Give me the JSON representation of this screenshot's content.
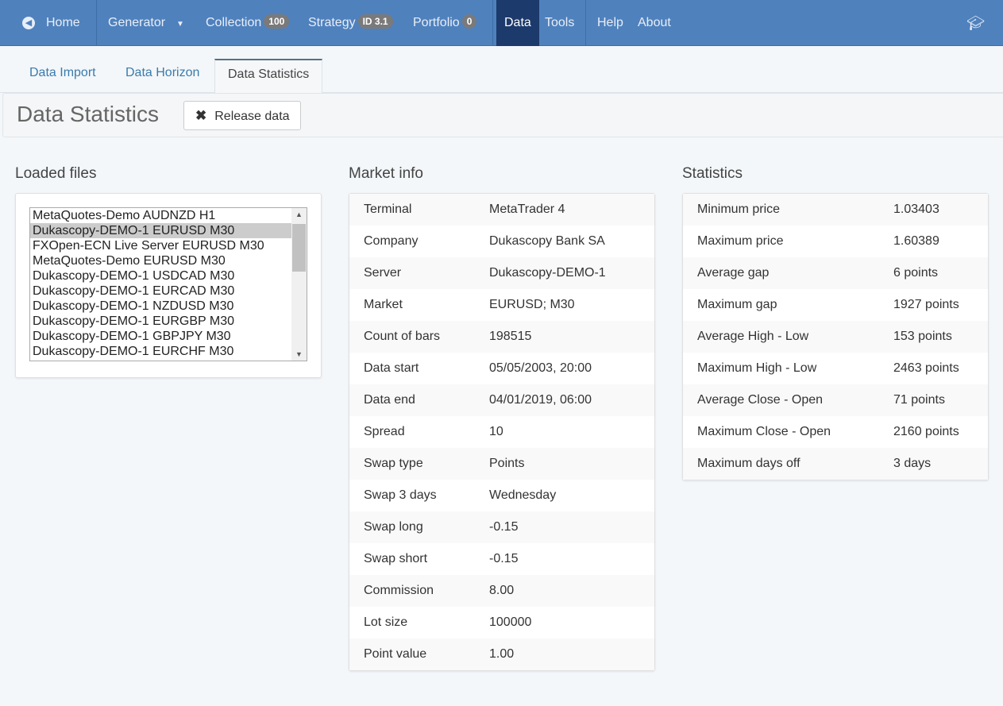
{
  "nav": {
    "home": "Home",
    "generator": "Generator",
    "collection": "Collection",
    "collection_count": "100",
    "strategy": "Strategy",
    "strategy_id": "ID 3.1",
    "portfolio": "Portfolio",
    "portfolio_count": "0",
    "data": "Data",
    "tools": "Tools",
    "help": "Help",
    "about": "About",
    "colors": {
      "bar": "#4f81bd",
      "active": "#1c3a6b"
    }
  },
  "tabs": [
    "Data Import",
    "Data Horizon",
    "Data Statistics"
  ],
  "header": {
    "title": "Data Statistics",
    "release_label": "Release data"
  },
  "loaded": {
    "title": "Loaded files",
    "selected": "Dukascopy-DEMO-1 EURUSD M30",
    "files": [
      "MetaQuotes-Demo AUDNZD H1",
      "Dukascopy-DEMO-1 EURUSD M30",
      "FXOpen-ECN Live Server EURUSD M30",
      "MetaQuotes-Demo EURUSD M30",
      "Dukascopy-DEMO-1 USDCAD M30",
      "Dukascopy-DEMO-1 EURCAD M30",
      "Dukascopy-DEMO-1 NZDUSD M30",
      "Dukascopy-DEMO-1 EURGBP M30",
      "Dukascopy-DEMO-1 GBPJPY M30",
      "Dukascopy-DEMO-1 EURCHF M30"
    ]
  },
  "market": {
    "title": "Market info",
    "rows": [
      [
        "Terminal",
        "MetaTrader 4"
      ],
      [
        "Company",
        "Dukascopy Bank SA"
      ],
      [
        "Server",
        "Dukascopy-DEMO-1"
      ],
      [
        "Market",
        "EURUSD; M30"
      ],
      [
        "Count of bars",
        "198515"
      ],
      [
        "Data start",
        "05/05/2003, 20:00"
      ],
      [
        "Data end",
        "04/01/2019, 06:00"
      ],
      [
        "Spread",
        "10"
      ],
      [
        "Swap type",
        "Points"
      ],
      [
        "Swap 3 days",
        "Wednesday"
      ],
      [
        "Swap long",
        "-0.15"
      ],
      [
        "Swap short",
        "-0.15"
      ],
      [
        "Commission",
        "8.00"
      ],
      [
        "Lot size",
        "100000"
      ],
      [
        "Point value",
        "1.00"
      ]
    ]
  },
  "stats": {
    "title": "Statistics",
    "rows": [
      [
        "Minimum price",
        "1.03403"
      ],
      [
        "Maximum price",
        "1.60389"
      ],
      [
        "Average gap",
        "6 points"
      ],
      [
        "Maximum gap",
        "1927 points"
      ],
      [
        "Average High - Low",
        "153 points"
      ],
      [
        "Maximum High - Low",
        "2463 points"
      ],
      [
        "Average Close - Open",
        "71 points"
      ],
      [
        "Maximum Close - Open",
        "2160 points"
      ],
      [
        "Maximum days off",
        "3 days"
      ]
    ]
  }
}
